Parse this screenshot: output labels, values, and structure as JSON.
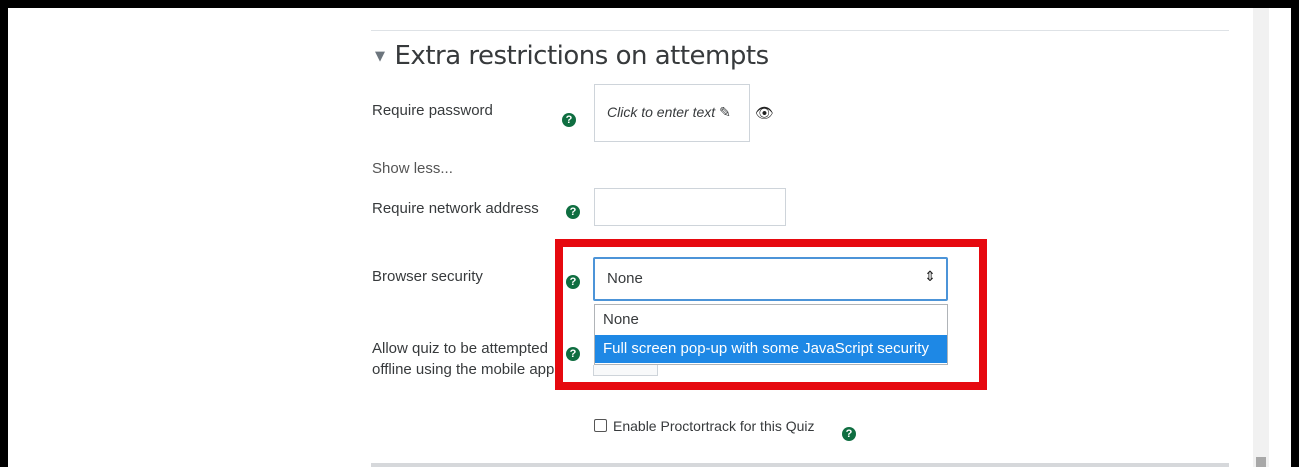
{
  "section": {
    "title": "Extra restrictions on attempts"
  },
  "password": {
    "label": "Require password",
    "placeholder": "Click to enter text"
  },
  "show_less": "Show less...",
  "network": {
    "label": "Require network address",
    "value": ""
  },
  "browser_security": {
    "label": "Browser security",
    "selected": "None",
    "options": [
      "None",
      "Full screen pop-up with some JavaScript security"
    ]
  },
  "offline": {
    "label_line1": "Allow quiz to be attempted",
    "label_line2": "offline using the mobile app"
  },
  "proctortrack": {
    "label": "Enable Proctortrack for this Quiz"
  },
  "colors": {
    "highlight_border": "#e6090f",
    "help_icon": "#0f6e41",
    "selected_option": "#1e88e5"
  }
}
